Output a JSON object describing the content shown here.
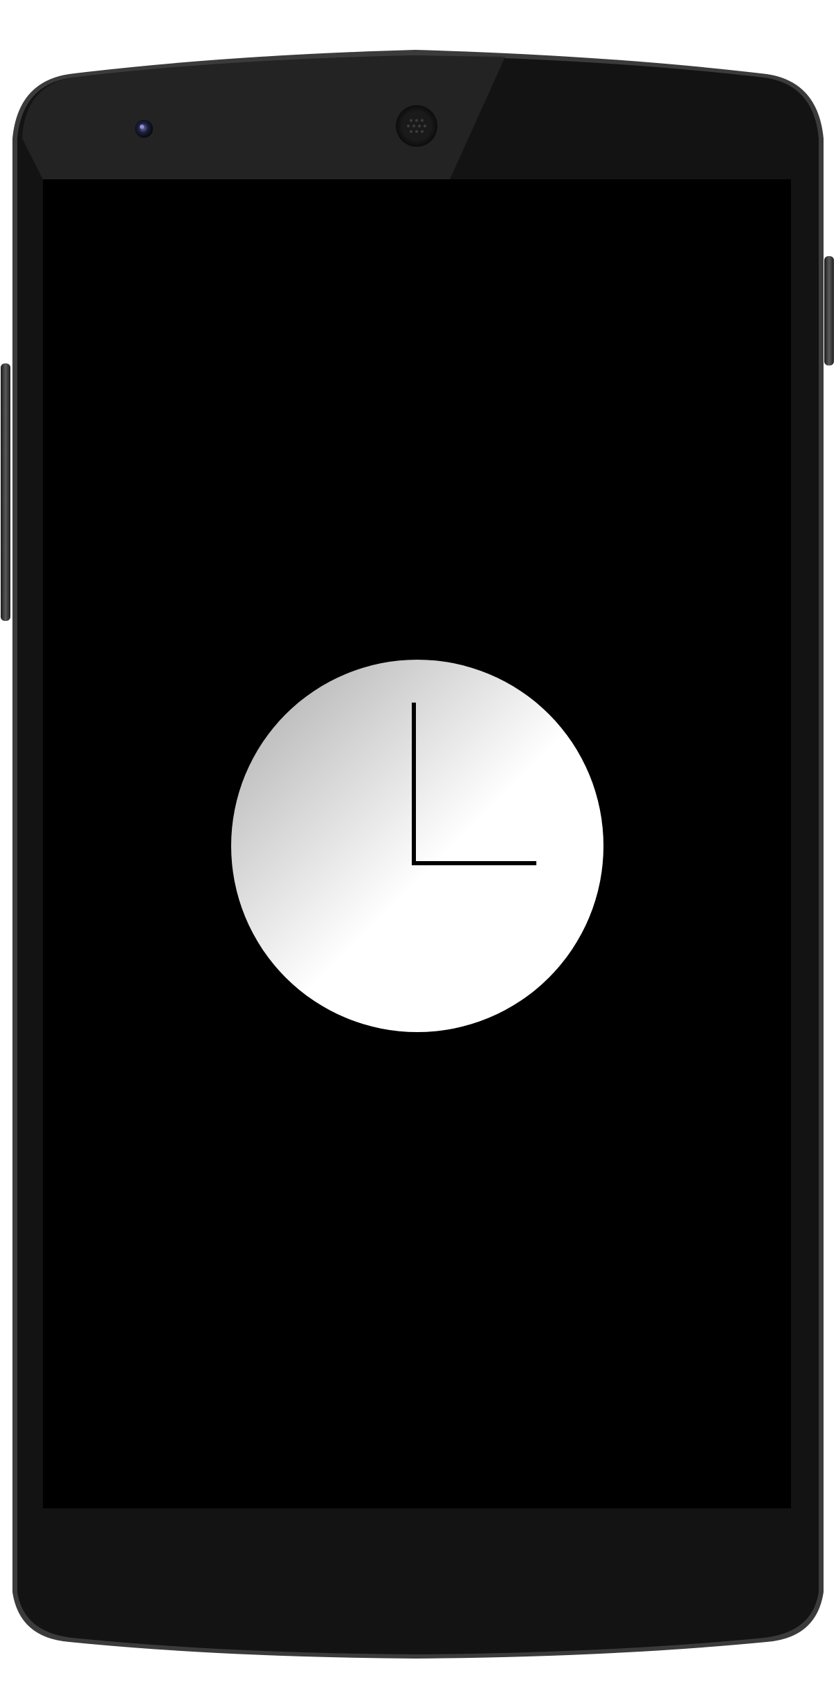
{
  "device": {
    "model_icon": "android-phone",
    "bezel_color": "#111111",
    "frame_color": "#3a3a3a",
    "screen_color": "#000000"
  },
  "clock_widget": {
    "icon": "clock-icon",
    "face_gradient": [
      "#a9a9a9",
      "#ffffff"
    ],
    "hand_color": "#000000",
    "time_shown": "3:00"
  }
}
